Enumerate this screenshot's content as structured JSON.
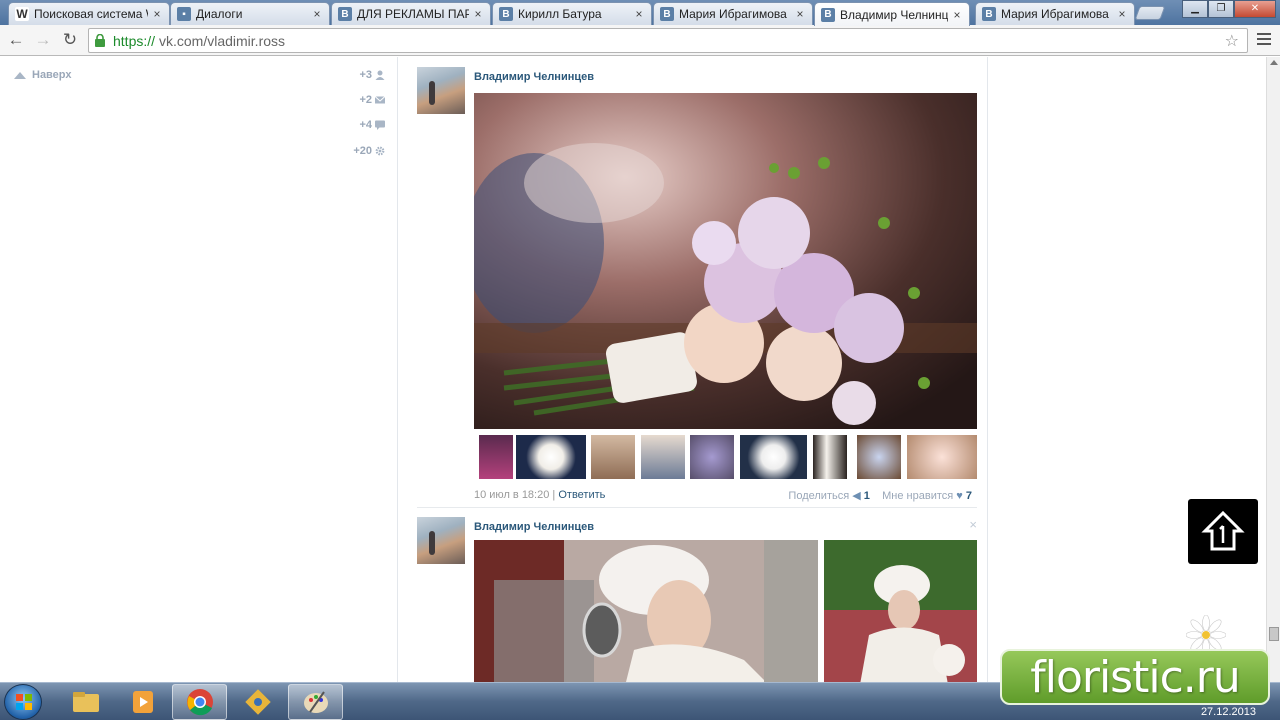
{
  "browser": {
    "tabs": [
      {
        "label": "Поисковая система W",
        "favicon": "wikipedia-icon",
        "active": false
      },
      {
        "label": "Диалоги",
        "favicon": "vk-chat-icon",
        "active": false
      },
      {
        "label": "ДЛЯ РЕКЛАМЫ ПАРТ",
        "favicon": "vk-icon",
        "active": false
      },
      {
        "label": "Кирилл Батура",
        "favicon": "vk-icon",
        "active": false
      },
      {
        "label": "Мария Ибрагимова",
        "favicon": "vk-icon",
        "active": false
      },
      {
        "label": "Владимир Челнинце",
        "favicon": "vk-icon",
        "active": true
      },
      {
        "label": "Мария Ибрагимова",
        "favicon": "vk-icon",
        "active": false
      }
    ],
    "tab_close_glyph": "×",
    "favicon_letter_w": "W",
    "favicon_letter_vk": "В",
    "url_scheme": "https://",
    "url_rest": "vk.com/vladimir.ross"
  },
  "sidebar": {
    "go_up_label": "Наверх",
    "counters": [
      {
        "value": "+3",
        "icon": "friends-icon"
      },
      {
        "value": "+2",
        "icon": "messages-icon"
      },
      {
        "value": "+4",
        "icon": "comments-icon"
      },
      {
        "value": "+20",
        "icon": "settings-icon"
      }
    ]
  },
  "posts": [
    {
      "author": "Владимир Челнинцев",
      "date": "10 июл в 18:20",
      "reply_label": "Ответить",
      "share_label": "Поделиться",
      "share_count": "1",
      "like_label": "Мне нравится",
      "like_count": "7"
    },
    {
      "author": "Владимир Челнинцев"
    }
  ],
  "taskbar": {
    "date": "27.12.2013",
    "apps": [
      "explorer",
      "media-player",
      "chrome",
      "paint-tools",
      "paint"
    ]
  },
  "watermark": {
    "text": "floristic.ru"
  },
  "colors": {
    "vk_link": "#2b587a",
    "muted": "#9aa7b8",
    "https_green": "#1b8a2a"
  }
}
